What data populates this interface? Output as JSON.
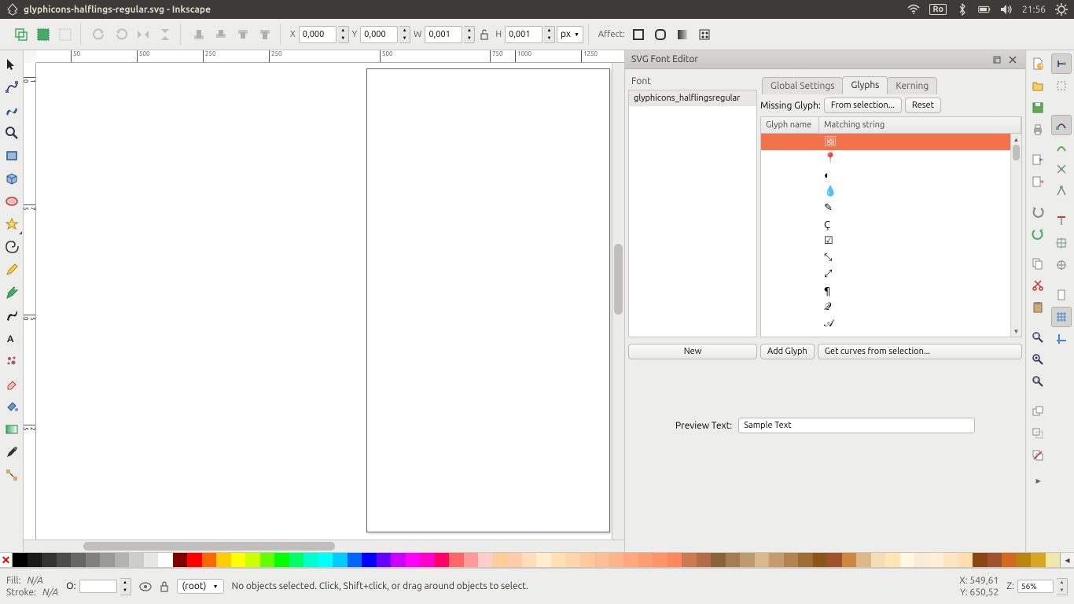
{
  "system_panel": {
    "app_icon_label": "inkscape-logo",
    "title": "glyphicons-halflings-regular.svg - Inkscape",
    "keyboard_indicator": "Ro",
    "time": "21:56"
  },
  "main_toolbar": {
    "x_label": "X",
    "x_value": "0,000",
    "y_label": "Y",
    "y_value": "0,000",
    "w_label": "W",
    "w_value": "0,001",
    "h_label": "H",
    "h_value": "0,001",
    "unit": "px",
    "affect_label": "Affect:"
  },
  "ruler_h": [
    "-50",
    "50",
    "500",
    "250",
    "250",
    "500",
    "750",
    "1000",
    "1250"
  ],
  "ruler_v": [
    "0",
    "1000",
    "750",
    "500",
    "250"
  ],
  "font_editor": {
    "title": "SVG Font Editor",
    "font_header": "Font",
    "font_name": "glyphicons_halflingsregular",
    "tabs": {
      "global": "Global Settings",
      "glyphs": "Glyphs",
      "kerning": "Kerning"
    },
    "missing_glyph_label": "Missing Glyph:",
    "from_selection": "From selection...",
    "reset": "Reset",
    "col_glyph_name": "Glyph name",
    "col_matching": "Matching string",
    "glyph_rows": [
      {
        "name": "",
        "match": "🖼",
        "selected": true
      },
      {
        "name": "",
        "match": "📍"
      },
      {
        "name": "",
        "match": "◐"
      },
      {
        "name": "",
        "match": "💧"
      },
      {
        "name": "",
        "match": "✎"
      },
      {
        "name": "",
        "match": "Ç"
      },
      {
        "name": "",
        "match": "☑"
      },
      {
        "name": "",
        "match": "⤡"
      },
      {
        "name": "",
        "match": "⤢"
      },
      {
        "name": "",
        "match": "¶"
      },
      {
        "name": "",
        "match": "𝒬"
      },
      {
        "name": "",
        "match": "𝒜"
      }
    ],
    "new_btn": "New",
    "add_glyph_btn": "Add Glyph",
    "get_curves_btn": "Get curves from selection...",
    "preview_label": "Preview Text:",
    "preview_value": "Sample Text"
  },
  "status_bar": {
    "fill_label": "Fill:",
    "fill_value": "N/A",
    "stroke_label": "Stroke:",
    "stroke_value": "N/A",
    "opacity_label": "O:",
    "opacity_value": "",
    "layer": "(root)",
    "message": "No objects selected. Click, Shift+click, or drag around objects to select.",
    "x_label": "X:",
    "x_value": "549,61",
    "y_label": "Y:",
    "y_value": "650,52",
    "z_label": "Z:",
    "z_value": "56%"
  },
  "palette_colors": [
    "#000000",
    "#1a1a1a",
    "#333333",
    "#4d4d4d",
    "#666666",
    "#808080",
    "#999999",
    "#b3b3b3",
    "#cccccc",
    "#e6e6e6",
    "#ffffff",
    "#800000",
    "#ff0000",
    "#ff6600",
    "#ffcc00",
    "#ffff00",
    "#ccff00",
    "#66ff00",
    "#00ff00",
    "#00ff66",
    "#00ffcc",
    "#00ffff",
    "#00ccff",
    "#0066ff",
    "#0000ff",
    "#6600ff",
    "#cc00ff",
    "#ff00ff",
    "#ff00cc",
    "#ff0066",
    "#ff6666",
    "#ff9999",
    "#ffcccc",
    "#ffcc99",
    "#ffccaa",
    "#ffddbb",
    "#ffeecc",
    "#ffe0b3",
    "#ffd4aa",
    "#ffc99e",
    "#ffbe93",
    "#ffb388",
    "#ffa87d",
    "#ff9d72",
    "#ff9266",
    "#ff875b",
    "#cc7a52",
    "#b36b48",
    "#8c6239",
    "#a67c52",
    "#bf9a6e",
    "#d9b88a",
    "#c69c6d",
    "#b38450",
    "#9f6c34",
    "#8c5417",
    "#a0522d",
    "#cd853f",
    "#deb887",
    "#f5deb3",
    "#ffe4b5",
    "#fff8dc",
    "#faebd7",
    "#ffefd5",
    "#ffe4c4",
    "#ffdead",
    "#8b4513",
    "#a0522d",
    "#d2691e",
    "#b8860b",
    "#daa520",
    "#eee8aa"
  ]
}
